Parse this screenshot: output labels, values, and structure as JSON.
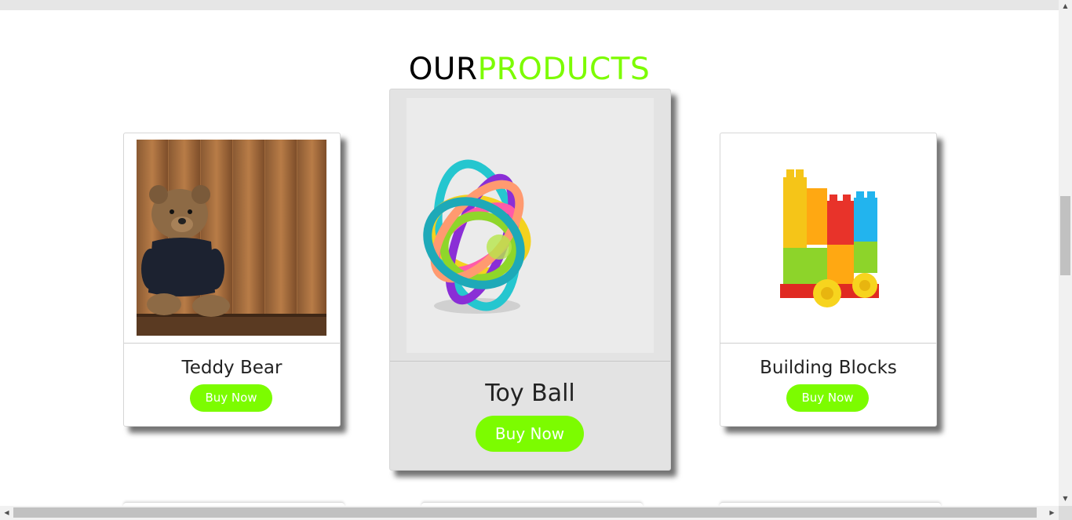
{
  "header": {
    "title_part1": "OUR",
    "title_part2": "PRODUCTS"
  },
  "colors": {
    "accent": "#7cfc00",
    "text": "#222222"
  },
  "products": [
    {
      "name": "Teddy Bear",
      "button": "Buy Now",
      "image": "teddy-bear-image"
    },
    {
      "name": "Toy Ball",
      "button": "Buy Now",
      "image": "toy-ball-image"
    },
    {
      "name": "Building Blocks",
      "button": "Buy Now",
      "image": "building-blocks-image"
    }
  ],
  "scrollbars": {
    "vertical_arrow_up": "▲",
    "vertical_arrow_down": "▼",
    "horizontal_arrow_left": "◀",
    "horizontal_arrow_right": "▶"
  }
}
